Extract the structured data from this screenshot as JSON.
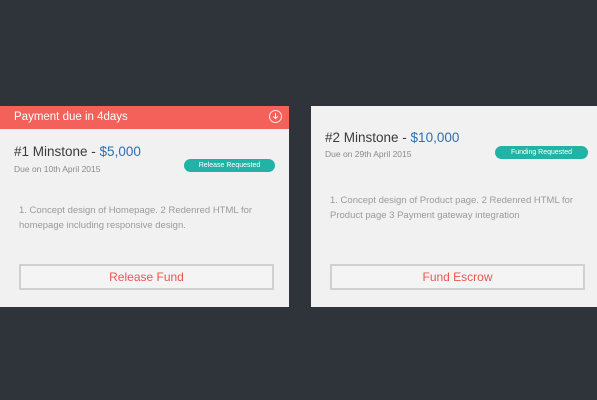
{
  "milestones": [
    {
      "banner": "Payment due in 4days",
      "banner_icon": "download-circle-icon",
      "title": "#1 Minstone - ",
      "amount": "$5,000",
      "due": "Due on 10th April 2015",
      "badge": "Release Requested",
      "description": "1. Concept design of Homepage. 2 Redenred HTML  for homepage including responsive design.",
      "action": "Release Fund"
    },
    {
      "title": "#2 Minstone - ",
      "amount": "$10,000",
      "due": "Due on 29th April 2015",
      "badge": "Funding  Requested",
      "description": "1. Concept design of Product page. 2 Redenred HTML  for Product page 3  Payment gateway integration",
      "action": "Fund Escrow"
    }
  ],
  "colors": {
    "background": "#2f343b",
    "card": "#f1f1f1",
    "banner": "#f4605a",
    "badge": "#23b3a6",
    "amount": "#2c6fb3",
    "action_text": "#e8574f"
  }
}
